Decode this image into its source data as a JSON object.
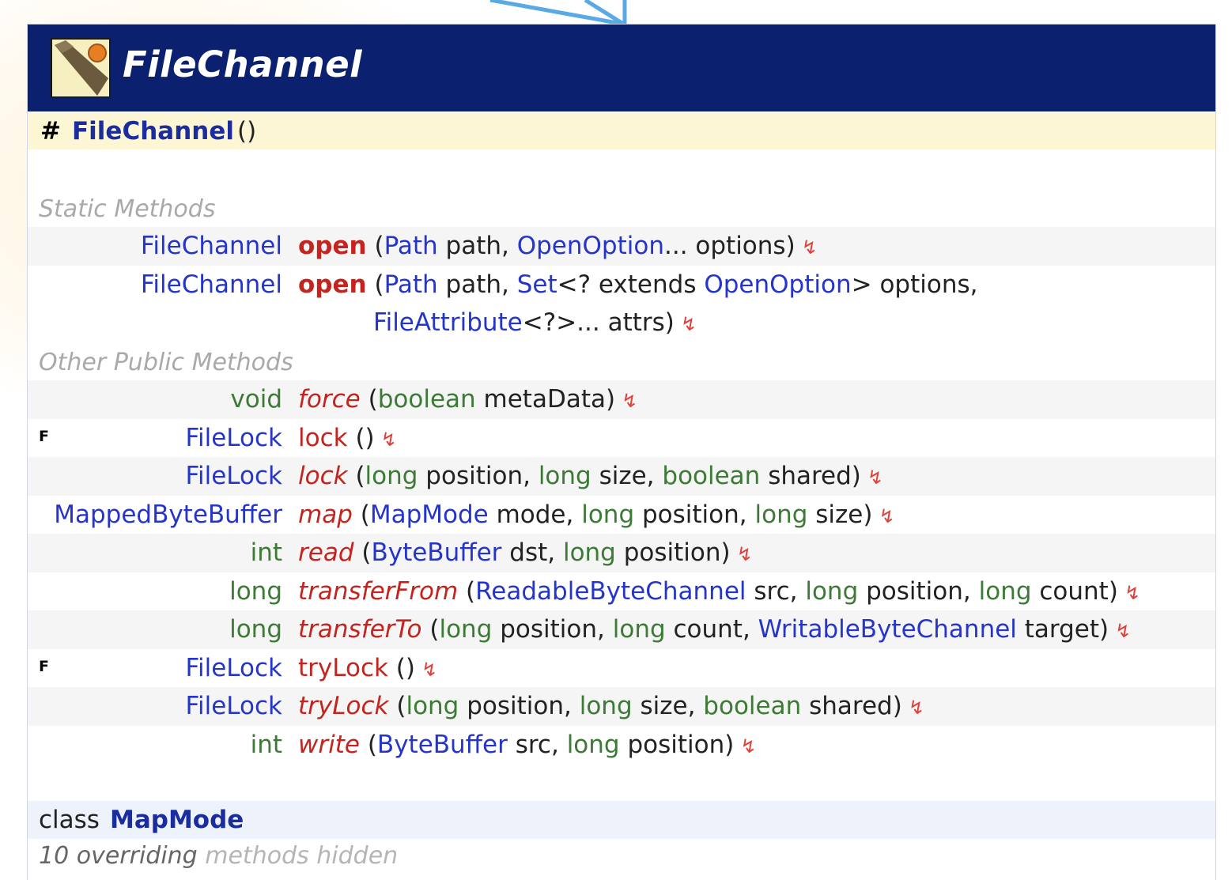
{
  "class": {
    "name": "FileChannel",
    "icon": "abstract-class-icon",
    "constructor": {
      "modifier": "#",
      "name": "FileChannel",
      "params": "()"
    }
  },
  "sections": {
    "static_label": "Static Methods",
    "public_label": "Other Public Methods"
  },
  "static_methods": [
    {
      "ret": "FileChannel",
      "name": "open",
      "line1": [
        [
          "(",
          "p"
        ],
        [
          "Path",
          "o"
        ],
        [
          " path, ",
          "p"
        ],
        [
          "OpenOption",
          "o"
        ],
        [
          "... options)",
          "p"
        ]
      ]
    },
    {
      "ret": "FileChannel",
      "name": "open",
      "line1": [
        [
          "(",
          "p"
        ],
        [
          "Path",
          "o"
        ],
        [
          " path, ",
          "p"
        ],
        [
          "Set",
          "o"
        ],
        [
          "<? extends ",
          "p"
        ],
        [
          "OpenOption",
          "o"
        ],
        [
          "> options,",
          "p"
        ]
      ],
      "line2": [
        [
          "FileAttribute",
          "o"
        ],
        [
          "<?>... attrs)",
          "p"
        ]
      ]
    }
  ],
  "public_methods": [
    {
      "flag": "",
      "ret": "void",
      "ret_kind": "prim",
      "name": "force",
      "style": "abstract",
      "params": [
        [
          "(",
          "p"
        ],
        [
          "boolean",
          "g"
        ],
        [
          " metaData)",
          "p"
        ]
      ]
    },
    {
      "flag": "F",
      "ret": "FileLock",
      "ret_kind": "obj",
      "name": "lock",
      "style": "plain",
      "params": [
        [
          "()",
          "p"
        ]
      ]
    },
    {
      "flag": "",
      "ret": "FileLock",
      "ret_kind": "obj",
      "name": "lock",
      "style": "abstract",
      "params": [
        [
          "(",
          "p"
        ],
        [
          "long",
          "g"
        ],
        [
          " position, ",
          "p"
        ],
        [
          "long",
          "g"
        ],
        [
          " size, ",
          "p"
        ],
        [
          "boolean",
          "g"
        ],
        [
          " shared)",
          "p"
        ]
      ]
    },
    {
      "flag": "",
      "ret": "MappedByteBuffer",
      "ret_kind": "obj",
      "name": "map",
      "style": "abstract",
      "params": [
        [
          "(",
          "p"
        ],
        [
          "MapMode",
          "o"
        ],
        [
          " mode, ",
          "p"
        ],
        [
          "long",
          "g"
        ],
        [
          " position, ",
          "p"
        ],
        [
          "long",
          "g"
        ],
        [
          " size)",
          "p"
        ]
      ]
    },
    {
      "flag": "",
      "ret": "int",
      "ret_kind": "prim",
      "name": "read",
      "style": "abstract",
      "params": [
        [
          "(",
          "p"
        ],
        [
          "ByteBuffer",
          "o"
        ],
        [
          " dst, ",
          "p"
        ],
        [
          "long",
          "g"
        ],
        [
          " position)",
          "p"
        ]
      ]
    },
    {
      "flag": "",
      "ret": "long",
      "ret_kind": "prim",
      "name": "transferFrom",
      "style": "abstract",
      "params": [
        [
          "(",
          "p"
        ],
        [
          "ReadableByteChannel",
          "o"
        ],
        [
          " src, ",
          "p"
        ],
        [
          "long",
          "g"
        ],
        [
          " position, ",
          "p"
        ],
        [
          "long",
          "g"
        ],
        [
          " count)",
          "p"
        ]
      ]
    },
    {
      "flag": "",
      "ret": "long",
      "ret_kind": "prim",
      "name": "transferTo",
      "style": "abstract",
      "params": [
        [
          "(",
          "p"
        ],
        [
          "long",
          "g"
        ],
        [
          " position, ",
          "p"
        ],
        [
          "long",
          "g"
        ],
        [
          " count, ",
          "p"
        ],
        [
          "WritableByteChannel",
          "o"
        ],
        [
          " target)",
          "p"
        ]
      ]
    },
    {
      "flag": "F",
      "ret": "FileLock",
      "ret_kind": "obj",
      "name": "tryLock",
      "style": "plain",
      "params": [
        [
          "()",
          "p"
        ]
      ]
    },
    {
      "flag": "",
      "ret": "FileLock",
      "ret_kind": "obj",
      "name": "tryLock",
      "style": "abstract",
      "params": [
        [
          "(",
          "p"
        ],
        [
          "long",
          "g"
        ],
        [
          " position, ",
          "p"
        ],
        [
          "long",
          "g"
        ],
        [
          " size, ",
          "p"
        ],
        [
          "boolean",
          "g"
        ],
        [
          " shared)",
          "p"
        ]
      ]
    },
    {
      "flag": "",
      "ret": "int",
      "ret_kind": "prim",
      "name": "write",
      "style": "abstract",
      "params": [
        [
          "(",
          "p"
        ],
        [
          "ByteBuffer",
          "o"
        ],
        [
          " src, ",
          "p"
        ],
        [
          "long",
          "g"
        ],
        [
          " position)",
          "p"
        ]
      ]
    }
  ],
  "throws_icon": "throws-icon",
  "inner_class": {
    "keyword": "class",
    "name": "MapMode"
  },
  "footer": {
    "count": "10 overriding",
    "rest": " methods hidden"
  },
  "colors": {
    "title_bar": "#0b2170",
    "constructor_row": "#fcf6d4",
    "object_type": "#2535c9",
    "primitive_type": "#3c7a36",
    "method_name": "#c4231e"
  }
}
